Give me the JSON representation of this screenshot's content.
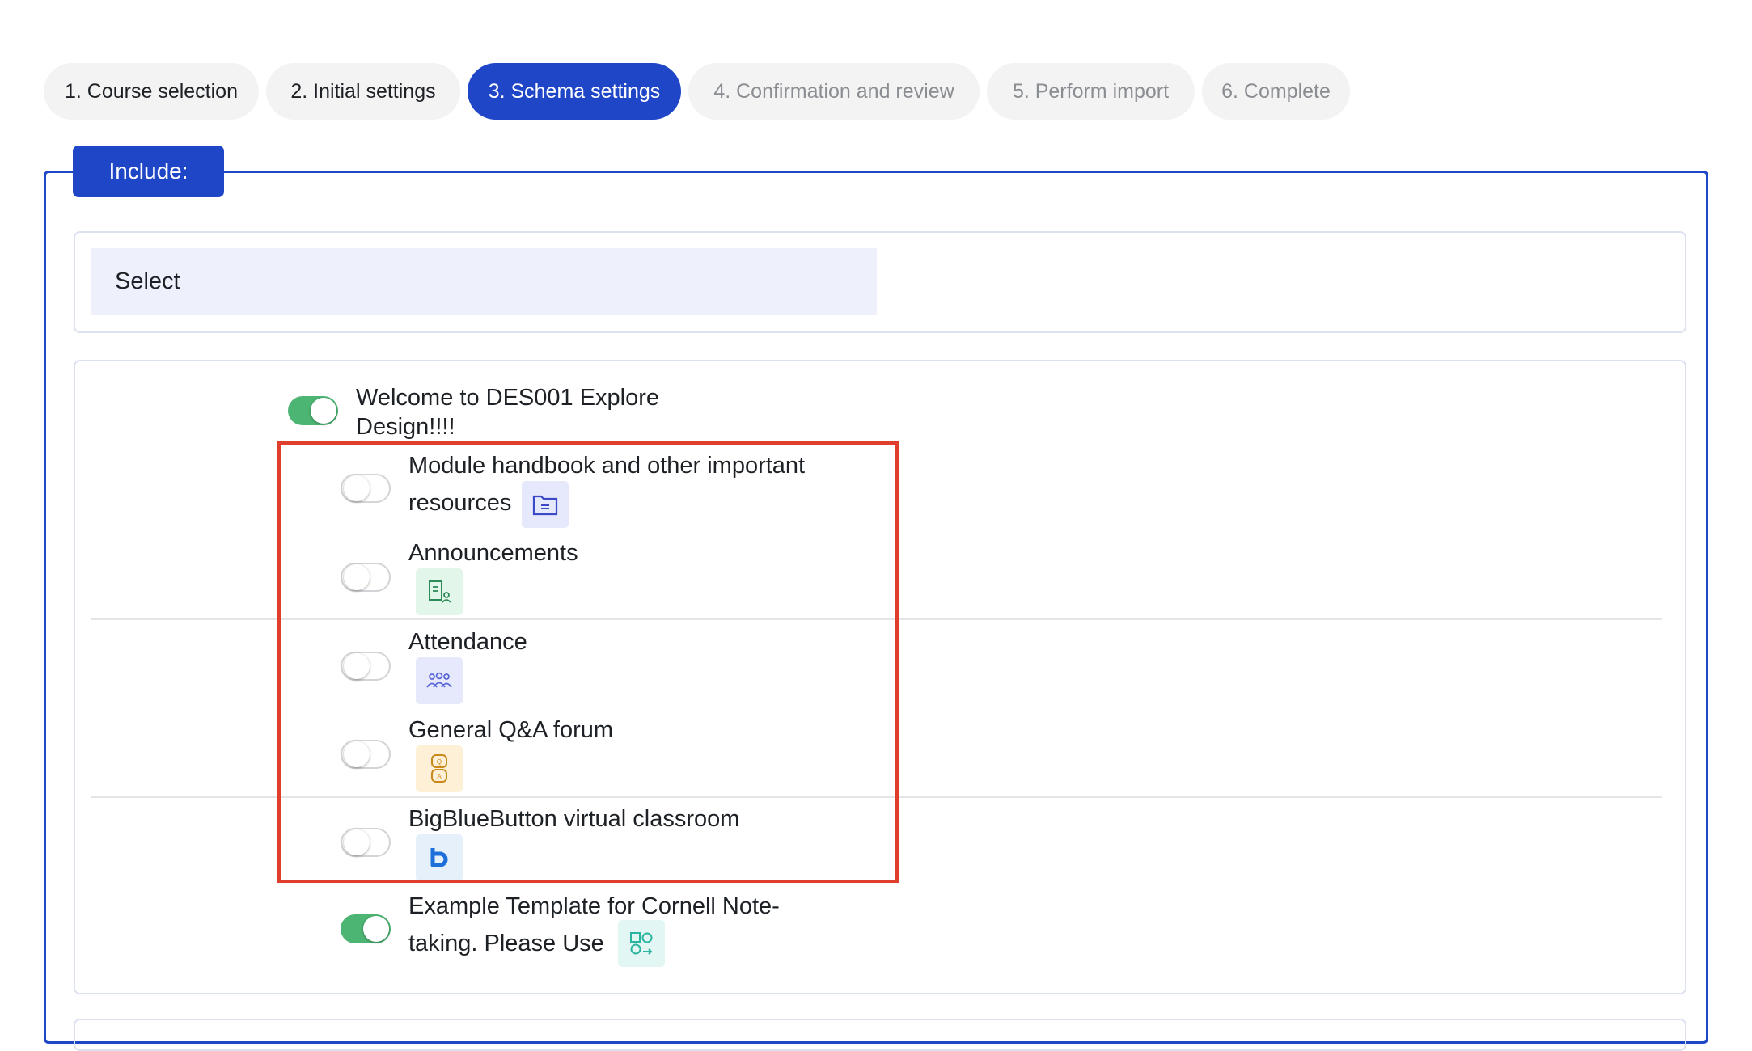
{
  "steps": [
    {
      "label": "1. Course selection",
      "state": "done"
    },
    {
      "label": "2. Initial settings",
      "state": "done"
    },
    {
      "label": "3. Schema settings",
      "state": "active"
    },
    {
      "label": "4. Confirmation and review",
      "state": "future"
    },
    {
      "label": "5. Perform import",
      "state": "future"
    },
    {
      "label": "6. Complete",
      "state": "future"
    }
  ],
  "include_legend": "Include:",
  "select_label": "Select",
  "section": {
    "title_line1": "Welcome to DES001 Explore",
    "title_line2": "Design!!!!",
    "enabled": true
  },
  "activities": [
    {
      "line1": "Module handbook and other important",
      "line2": "resources",
      "icon": "folder-icon",
      "enabled": false
    },
    {
      "line1": "Announcements",
      "icon": "announcements-forum-icon",
      "enabled": false
    },
    {
      "line1": "Attendance",
      "icon": "attendance-group-icon",
      "enabled": false
    },
    {
      "line1": "General Q&A forum",
      "icon": "qa-forum-icon",
      "enabled": false
    },
    {
      "line1": "BigBlueButton virtual classroom",
      "icon": "bigbluebutton-icon",
      "enabled": false
    },
    {
      "line1": "Example Template for Cornell Note-",
      "line2": "taking. Please Use",
      "icon": "template-icon",
      "enabled": true
    }
  ],
  "colors": {
    "accent": "#1f46c7",
    "toggle_on": "#4db573",
    "highlight": "#e03e2d",
    "folder_icon_bg": "#e6e8fb",
    "announcements_icon_bg": "#e2f6ea",
    "attendance_icon_bg": "#e6e8fb",
    "qa_icon_bg": "#fdf0d6",
    "bbb_icon_bg": "#e6f0fb",
    "template_icon_bg": "#e2f6f3"
  }
}
